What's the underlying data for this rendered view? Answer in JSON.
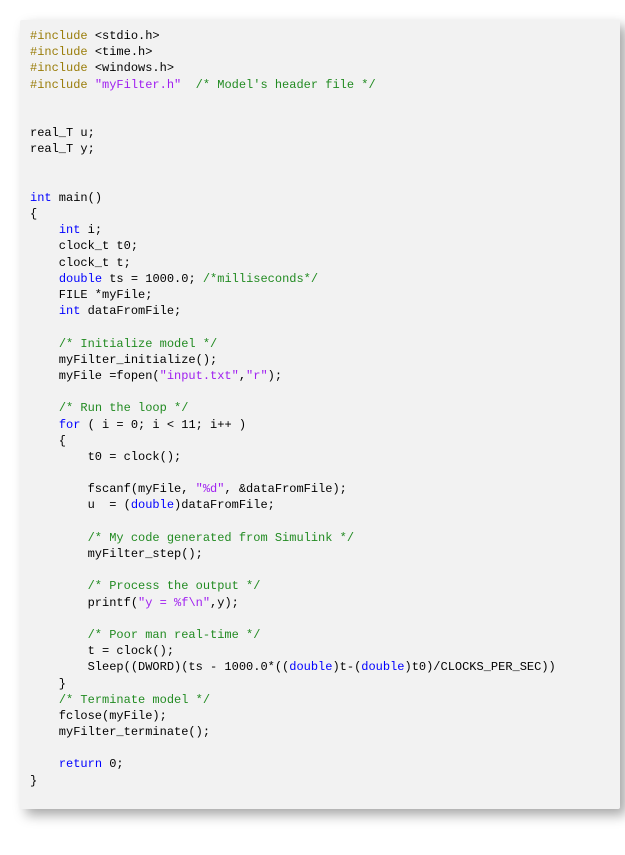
{
  "code": {
    "lines": [
      {
        "tokens": [
          {
            "cls": "tok-preproc",
            "t": "#include "
          },
          {
            "cls": "tok-plain",
            "t": "<stdio.h>"
          }
        ]
      },
      {
        "tokens": [
          {
            "cls": "tok-preproc",
            "t": "#include "
          },
          {
            "cls": "tok-plain",
            "t": "<time.h>"
          }
        ]
      },
      {
        "tokens": [
          {
            "cls": "tok-preproc",
            "t": "#include "
          },
          {
            "cls": "tok-plain",
            "t": "<windows.h>"
          }
        ]
      },
      {
        "tokens": [
          {
            "cls": "tok-preproc",
            "t": "#include "
          },
          {
            "cls": "tok-string",
            "t": "\"myFilter.h\""
          },
          {
            "cls": "tok-plain",
            "t": "  "
          },
          {
            "cls": "tok-comment",
            "t": "/* Model's header file */"
          }
        ]
      },
      {
        "tokens": [
          {
            "cls": "tok-plain",
            "t": ""
          }
        ]
      },
      {
        "tokens": [
          {
            "cls": "tok-plain",
            "t": ""
          }
        ]
      },
      {
        "tokens": [
          {
            "cls": "tok-plain",
            "t": "real_T u;"
          }
        ]
      },
      {
        "tokens": [
          {
            "cls": "tok-plain",
            "t": "real_T y;"
          }
        ]
      },
      {
        "tokens": [
          {
            "cls": "tok-plain",
            "t": ""
          }
        ]
      },
      {
        "tokens": [
          {
            "cls": "tok-plain",
            "t": ""
          }
        ]
      },
      {
        "tokens": [
          {
            "cls": "tok-keyword",
            "t": "int"
          },
          {
            "cls": "tok-plain",
            "t": " main()"
          }
        ]
      },
      {
        "tokens": [
          {
            "cls": "tok-plain",
            "t": "{"
          }
        ]
      },
      {
        "tokens": [
          {
            "cls": "tok-plain",
            "t": "    "
          },
          {
            "cls": "tok-keyword",
            "t": "int"
          },
          {
            "cls": "tok-plain",
            "t": " i;"
          }
        ]
      },
      {
        "tokens": [
          {
            "cls": "tok-plain",
            "t": "    clock_t t0;"
          }
        ]
      },
      {
        "tokens": [
          {
            "cls": "tok-plain",
            "t": "    clock_t t;"
          }
        ]
      },
      {
        "tokens": [
          {
            "cls": "tok-plain",
            "t": "    "
          },
          {
            "cls": "tok-keyword",
            "t": "double"
          },
          {
            "cls": "tok-plain",
            "t": " ts = 1000.0; "
          },
          {
            "cls": "tok-comment",
            "t": "/*milliseconds*/"
          }
        ]
      },
      {
        "tokens": [
          {
            "cls": "tok-plain",
            "t": "    FILE *myFile;"
          }
        ]
      },
      {
        "tokens": [
          {
            "cls": "tok-plain",
            "t": "    "
          },
          {
            "cls": "tok-keyword",
            "t": "int"
          },
          {
            "cls": "tok-plain",
            "t": " dataFromFile;"
          }
        ]
      },
      {
        "tokens": [
          {
            "cls": "tok-plain",
            "t": ""
          }
        ]
      },
      {
        "tokens": [
          {
            "cls": "tok-plain",
            "t": "    "
          },
          {
            "cls": "tok-comment",
            "t": "/* Initialize model */"
          }
        ]
      },
      {
        "tokens": [
          {
            "cls": "tok-plain",
            "t": "    myFilter_initialize();"
          }
        ]
      },
      {
        "tokens": [
          {
            "cls": "tok-plain",
            "t": "    myFile =fopen("
          },
          {
            "cls": "tok-string",
            "t": "\"input.txt\""
          },
          {
            "cls": "tok-plain",
            "t": ","
          },
          {
            "cls": "tok-string",
            "t": "\"r\""
          },
          {
            "cls": "tok-plain",
            "t": ");"
          }
        ]
      },
      {
        "tokens": [
          {
            "cls": "tok-plain",
            "t": ""
          }
        ]
      },
      {
        "tokens": [
          {
            "cls": "tok-plain",
            "t": "    "
          },
          {
            "cls": "tok-comment",
            "t": "/* Run the loop */"
          }
        ]
      },
      {
        "tokens": [
          {
            "cls": "tok-plain",
            "t": "    "
          },
          {
            "cls": "tok-keyword",
            "t": "for"
          },
          {
            "cls": "tok-plain",
            "t": " ( i = 0; i < 11; i++ )"
          }
        ]
      },
      {
        "tokens": [
          {
            "cls": "tok-plain",
            "t": "    {"
          }
        ]
      },
      {
        "tokens": [
          {
            "cls": "tok-plain",
            "t": "        t0 = clock();"
          }
        ]
      },
      {
        "tokens": [
          {
            "cls": "tok-plain",
            "t": ""
          }
        ]
      },
      {
        "tokens": [
          {
            "cls": "tok-plain",
            "t": "        fscanf(myFile, "
          },
          {
            "cls": "tok-string",
            "t": "\"%d\""
          },
          {
            "cls": "tok-plain",
            "t": ", &dataFromFile);"
          }
        ]
      },
      {
        "tokens": [
          {
            "cls": "tok-plain",
            "t": "        u  = ("
          },
          {
            "cls": "tok-keyword",
            "t": "double"
          },
          {
            "cls": "tok-plain",
            "t": ")dataFromFile;"
          }
        ]
      },
      {
        "tokens": [
          {
            "cls": "tok-plain",
            "t": ""
          }
        ]
      },
      {
        "tokens": [
          {
            "cls": "tok-plain",
            "t": "        "
          },
          {
            "cls": "tok-comment",
            "t": "/* My code generated from Simulink */"
          }
        ]
      },
      {
        "tokens": [
          {
            "cls": "tok-plain",
            "t": "        myFilter_step();"
          }
        ]
      },
      {
        "tokens": [
          {
            "cls": "tok-plain",
            "t": ""
          }
        ]
      },
      {
        "tokens": [
          {
            "cls": "tok-plain",
            "t": "        "
          },
          {
            "cls": "tok-comment",
            "t": "/* Process the output */"
          }
        ]
      },
      {
        "tokens": [
          {
            "cls": "tok-plain",
            "t": "        printf("
          },
          {
            "cls": "tok-string",
            "t": "\"y = %f\\n\""
          },
          {
            "cls": "tok-plain",
            "t": ",y);"
          }
        ]
      },
      {
        "tokens": [
          {
            "cls": "tok-plain",
            "t": ""
          }
        ]
      },
      {
        "tokens": [
          {
            "cls": "tok-plain",
            "t": "        "
          },
          {
            "cls": "tok-comment",
            "t": "/* Poor man real-time */"
          }
        ]
      },
      {
        "tokens": [
          {
            "cls": "tok-plain",
            "t": "        t = clock();"
          }
        ]
      },
      {
        "tokens": [
          {
            "cls": "tok-plain",
            "t": "        Sleep((DWORD)(ts - 1000.0*(("
          },
          {
            "cls": "tok-keyword",
            "t": "double"
          },
          {
            "cls": "tok-plain",
            "t": ")t-("
          },
          {
            "cls": "tok-keyword",
            "t": "double"
          },
          {
            "cls": "tok-plain",
            "t": ")t0)/CLOCKS_PER_SEC))"
          }
        ]
      },
      {
        "tokens": [
          {
            "cls": "tok-plain",
            "t": "    }"
          }
        ]
      },
      {
        "tokens": [
          {
            "cls": "tok-plain",
            "t": "    "
          },
          {
            "cls": "tok-comment",
            "t": "/* Terminate model */"
          }
        ]
      },
      {
        "tokens": [
          {
            "cls": "tok-plain",
            "t": "    fclose(myFile);"
          }
        ]
      },
      {
        "tokens": [
          {
            "cls": "tok-plain",
            "t": "    myFilter_terminate();"
          }
        ]
      },
      {
        "tokens": [
          {
            "cls": "tok-plain",
            "t": ""
          }
        ]
      },
      {
        "tokens": [
          {
            "cls": "tok-plain",
            "t": "    "
          },
          {
            "cls": "tok-keyword",
            "t": "return"
          },
          {
            "cls": "tok-plain",
            "t": " 0;"
          }
        ]
      },
      {
        "tokens": [
          {
            "cls": "tok-plain",
            "t": "}"
          }
        ]
      }
    ]
  }
}
